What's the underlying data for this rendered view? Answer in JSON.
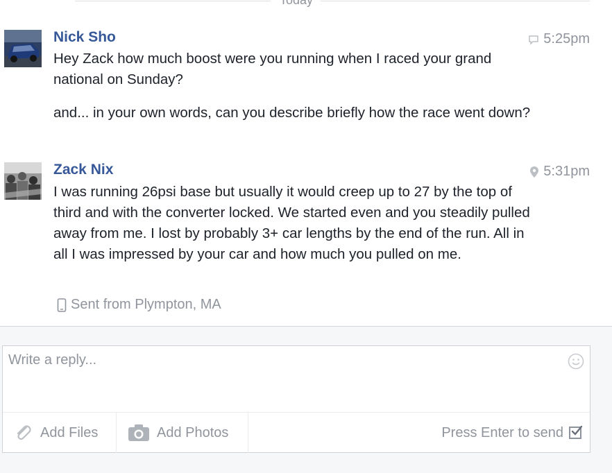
{
  "thread": {
    "day_divider": "Today",
    "messages": [
      {
        "author": "Nick Sho",
        "time": "5:25pm",
        "time_icon": "chat-bubble-icon",
        "paragraphs": [
          "Hey Zack how much boost were you running when I raced your grand national on Sunday?",
          "and... in your own words, can you describe briefly how the race went down?"
        ]
      },
      {
        "author": "Zack Nix",
        "time": "5:31pm",
        "time_icon": "location-pin-icon",
        "paragraphs": [
          "I was running 26psi base but usually it would creep up to 27 by the top of third and with the converter locked. We started even and you steadily pulled away from me. I lost by probably 3+ car lengths by the end of the run. All in all I was impressed by your car and how much you pulled on me."
        ],
        "sent_from": "Sent from Plympton, MA"
      }
    ]
  },
  "composer": {
    "placeholder": "Write a reply...",
    "add_files": "Add Files",
    "add_photos": "Add Photos",
    "press_enter": "Press Enter to send",
    "press_enter_checked": true
  },
  "colors": {
    "author": "#365899",
    "muted": "#90949c",
    "text": "#1d2129",
    "footer_bg": "#f6f7f9"
  }
}
